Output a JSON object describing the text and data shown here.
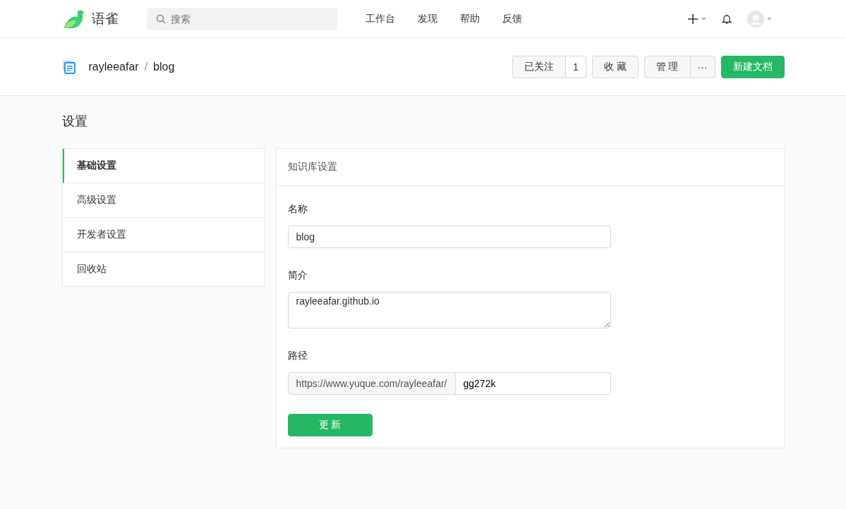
{
  "header": {
    "logo_text": "语雀",
    "search": {
      "placeholder": "搜索"
    },
    "nav": [
      "工作台",
      "发现",
      "帮助",
      "反馈"
    ]
  },
  "repo_bar": {
    "owner": "rayleeafar",
    "separator": "/",
    "name": "blog",
    "follow": {
      "label": "已关注",
      "count": "1"
    },
    "star": "收 藏",
    "manage": "管 理",
    "more": "···",
    "new_doc": "新建文档"
  },
  "page_title": "设置",
  "menu": [
    {
      "label": "基础设置",
      "selected": true
    },
    {
      "label": "高级设置",
      "selected": false
    },
    {
      "label": "开发者设置",
      "selected": false
    },
    {
      "label": "回收站",
      "selected": false
    }
  ],
  "panel": {
    "title": "知识库设置",
    "name": {
      "label": "名称",
      "value": "blog"
    },
    "desc": {
      "label": "简介",
      "value": "rayleeafar.github.io"
    },
    "path": {
      "label": "路径",
      "prefix": "https://www.yuque.com/rayleeafar/",
      "value": "gg272k"
    },
    "submit": "更 新"
  }
}
